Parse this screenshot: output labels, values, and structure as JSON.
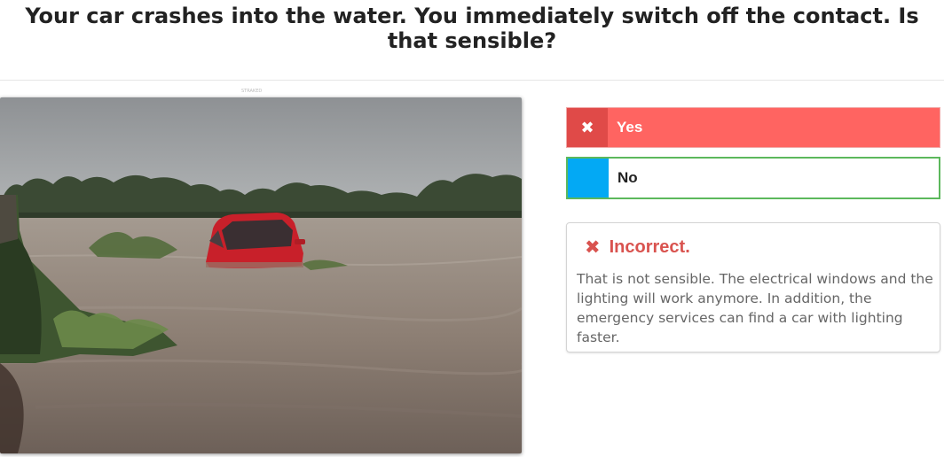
{
  "question": {
    "text": "Your car crashes into the water. You immediately switch off the contact. Is that sensible?"
  },
  "image": {
    "credit": "STRAKED"
  },
  "answers": [
    {
      "label": "Yes",
      "state": "selected-incorrect",
      "marker_icon": "close-icon",
      "color": "#ff6461",
      "marker_color": "#e04a48"
    },
    {
      "label": "No",
      "state": "correct",
      "marker_color": "#03a9f4",
      "border_color": "#5cb85c"
    }
  ],
  "feedback": {
    "title": "Incorrect.",
    "icon": "close-icon",
    "color": "#d9534f",
    "text": "That is not sensible. The electrical windows and the lighting will work anymore. In addition, the emergency services can find a car with lighting faster."
  }
}
